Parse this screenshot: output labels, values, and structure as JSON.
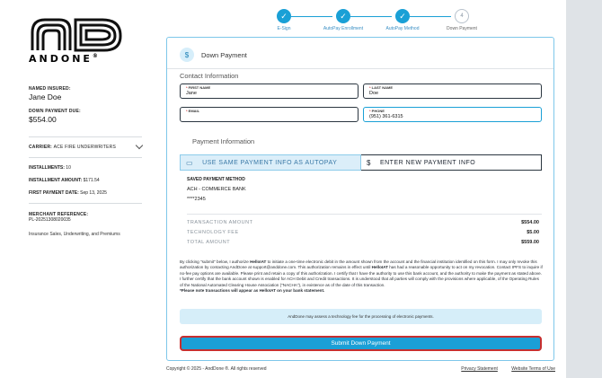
{
  "brand": {
    "name": "ANDONE",
    "reg": "®"
  },
  "sidebar": {
    "insured_label": "NAMED INSURED:",
    "insured_value": "Jane Doe",
    "down_label": "DOWN PAYMENT DUE:",
    "down_value": "$554.00",
    "carrier_label": "CARRIER:",
    "carrier_value": "ACE FIRE UNDERWRITERS",
    "installments_label": "INSTALLMENTS:",
    "installments_value": "10",
    "inst_amount_label": "INSTALLMENT AMOUNT:",
    "inst_amount_value": "$171.54",
    "first_date_label": "FIRST PAYMENT DATE:",
    "first_date_value": "Sep 13, 2025",
    "merchant_label": "MERCHANT REFERENCE:",
    "merchant_value": "PL-20251308020035",
    "merchant_desc": "Insurance Sales, Underwriting, and Premiums"
  },
  "stepper": {
    "steps": [
      {
        "label": "E-Sign",
        "state": "done"
      },
      {
        "label": "AutoPay Enrollment",
        "state": "done"
      },
      {
        "label": "AutoPay Method",
        "state": "done"
      },
      {
        "label": "Down Payment",
        "state": "pending",
        "number": "4"
      }
    ]
  },
  "card": {
    "title": "Down Payment",
    "contact_title": "Contact Information",
    "fields": {
      "first_name": {
        "label": "FIRST NAME",
        "value": "Jane"
      },
      "last_name": {
        "label": "LAST NAME",
        "value": "Doe"
      },
      "email": {
        "label": "EMAIL",
        "value": ""
      },
      "phone": {
        "label": "PHONE",
        "value": "(951) 361-6315"
      }
    },
    "payment_title": "Payment Information",
    "tabs": {
      "autopay": "USE SAME PAYMENT INFO AS AUTOPAY",
      "new": "ENTER NEW PAYMENT INFO"
    },
    "saved": {
      "heading": "SAVED PAYMENT METHOD",
      "bank": "ACH - COMMERCE BANK",
      "last4": "****2345"
    },
    "totals": [
      {
        "label": "TRANSACTION AMOUNT",
        "amount": "$554.00"
      },
      {
        "label": "TECHNOLOGY FEE",
        "amount": "$5.00"
      },
      {
        "label": "TOTAL AMOUNT",
        "amount": "$559.00"
      }
    ],
    "legal_1": "By clicking \"submit\" below, I authorize ",
    "legal_company": "HelloIAT",
    "legal_2": " to initiate a one-time electronic debit in the amount shown from the account and the financial institution identified on this form. I may only revoke this authorization by contacting AndDone at support@anddone.com. This authorization remains in effect until ",
    "legal_3": " has had a reasonable opportunity to act on my revocation. Contact IPFS to inquire if no-fee pay options are available. Please print and retain a copy of this authorization. I certify that I have the authority to use this bank account, and the authority to make the payment as stated above. I further certify that the bank account shown is enabled for ACH Debit and Credit transactions. It is understood that all parties will comply with the provisions where applicable, of the Operating Rules of the National Automated Clearing House Association (\"NACHA\"), in existence as of the date of this transaction.",
    "legal_note": "*Please note transactions will appear as HelloIAT on your bank statement.",
    "notice": "AndDone may assess a technology fee for the processing of electronic payments.",
    "submit": "Submit Down Payment"
  },
  "footer": {
    "copyright": "Copyright © 2025 - AndDone ®. All rights reserved",
    "privacy": "Privacy Statement",
    "terms": "Website Terms of Use"
  },
  "colors": {
    "accent": "#1b9fd6",
    "submit_border": "#c72f2f"
  }
}
